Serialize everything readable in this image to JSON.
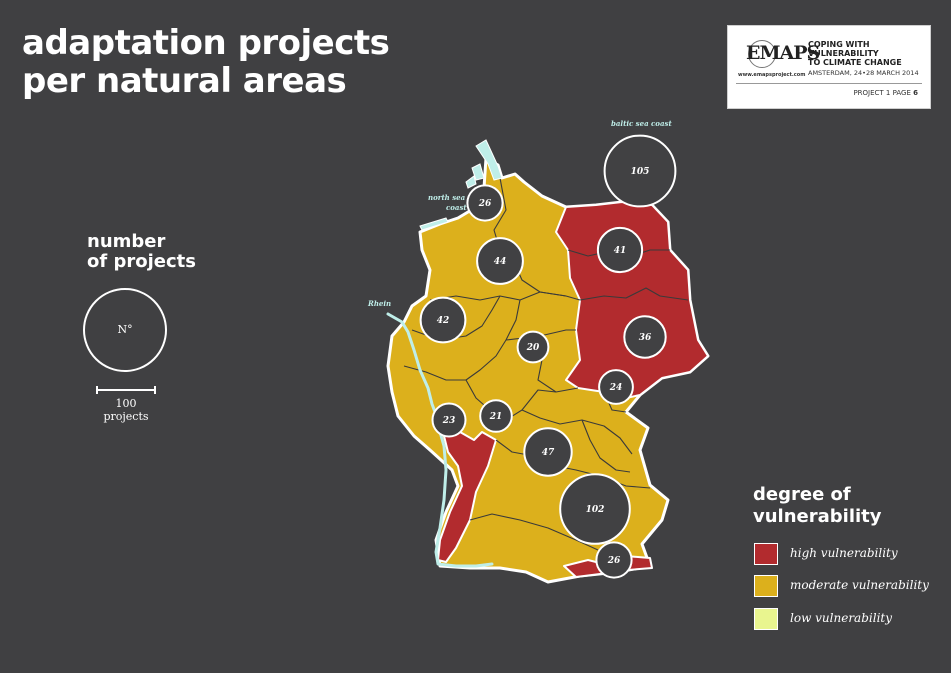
{
  "title": {
    "line1": "adaptation projects",
    "line2": "per natural areas"
  },
  "brand": {
    "logo_text": "EMAPS",
    "url": "www.emapsproject.com",
    "line1": "COPING WITH",
    "line2": "VULNERABILITY",
    "line3": "TO CLIMATE CHANGE",
    "date": "AMSTERDAM, 24•28 MARCH 2014",
    "page_prefix": "PROJECT 1 PAGE",
    "page_number": "6"
  },
  "size_legend": {
    "heading_line1": "number",
    "heading_line2": "of projects",
    "circle_label": "N°",
    "scale_value": "100",
    "scale_unit": "projects"
  },
  "water_labels": {
    "baltic": "baltic sea coast",
    "north_sea_line1": "north sea",
    "north_sea_line2": "coast",
    "rhein": "Rhein"
  },
  "areas": [
    {
      "id": "baltic-sea-coast",
      "projects": 105
    },
    {
      "id": "north-sea-coast",
      "projects": 26
    },
    {
      "id": "northeast-lowland",
      "projects": 41
    },
    {
      "id": "northwest-lowland",
      "projects": 44
    },
    {
      "id": "western-uplands-north",
      "projects": 42
    },
    {
      "id": "central-uplands",
      "projects": 20
    },
    {
      "id": "east-lowland-south",
      "projects": 36
    },
    {
      "id": "eastern-uplands",
      "projects": 24
    },
    {
      "id": "upper-rhine",
      "projects": 23
    },
    {
      "id": "southwest-uplands",
      "projects": 21
    },
    {
      "id": "south-scarplands",
      "projects": 47
    },
    {
      "id": "alpine-foreland",
      "projects": 102
    },
    {
      "id": "alps",
      "projects": 26
    }
  ],
  "vulnerability_legend": {
    "heading_line1": "degree of",
    "heading_line2": "vulnerability",
    "items": [
      {
        "label": "high vulnerability",
        "color": "#b22b2e"
      },
      {
        "label": "moderate vulnerability",
        "color": "#dcb01c"
      },
      {
        "label": "low vulnerability",
        "color": "#e9f58f"
      }
    ]
  },
  "colors": {
    "background": "#404042",
    "high": "#b22b2e",
    "moderate": "#dcb01c",
    "low": "#e9f58f",
    "water": "#bfeee9",
    "bubble": "#414143"
  }
}
